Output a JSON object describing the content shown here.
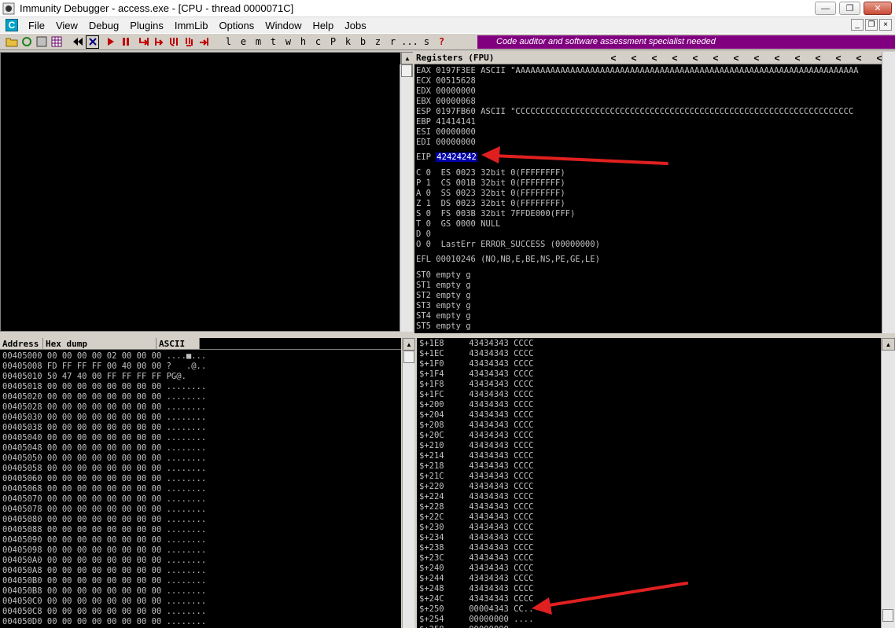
{
  "window": {
    "title": "Immunity Debugger - access.exe - [CPU - thread 0000071C]",
    "min": "—",
    "max": "❐",
    "close": "✕"
  },
  "menu": {
    "icon": "C",
    "items": [
      "File",
      "View",
      "Debug",
      "Plugins",
      "ImmLib",
      "Options",
      "Window",
      "Help",
      "Jobs"
    ],
    "mdi": [
      "_",
      "❐",
      "×"
    ]
  },
  "toolbar": {
    "letters": [
      "l",
      "e",
      "m",
      "t",
      "w",
      "h",
      "c",
      "P",
      "k",
      "b",
      "z",
      "r",
      "...",
      "s",
      "?"
    ],
    "banner": "Code auditor and software assessment specialist needed"
  },
  "registers": {
    "title": "Registers (FPU)",
    "chevrons": [
      "<",
      "<",
      "<",
      "<",
      "<",
      "<",
      "<",
      "<",
      "<",
      "<",
      "<",
      "<",
      "<",
      "<"
    ],
    "general": [
      "EAX 0197F3EE ASCII \"AAAAAAAAAAAAAAAAAAAAAAAAAAAAAAAAAAAAAAAAAAAAAAAAAAAAAAAAAAAAAAAAAAAAA",
      "ECX 00515628",
      "EDX 00000000",
      "EBX 00000068",
      "ESP 0197FB60 ASCII \"CCCCCCCCCCCCCCCCCCCCCCCCCCCCCCCCCCCCCCCCCCCCCCCCCCCCCCCCCCCCCCCCCCCC",
      "EBP 41414141",
      "ESI 00000000",
      "EDI 00000000"
    ],
    "eip_label": "EIP",
    "eip_value": "42424242",
    "flags": [
      "C 0  ES 0023 32bit 0(FFFFFFFF)",
      "P 1  CS 001B 32bit 0(FFFFFFFF)",
      "A 0  SS 0023 32bit 0(FFFFFFFF)",
      "Z 1  DS 0023 32bit 0(FFFFFFFF)",
      "S 0  FS 003B 32bit 7FFDE000(FFF)",
      "T 0  GS 0000 NULL",
      "D 0",
      "O 0  LastErr ERROR_SUCCESS (00000000)"
    ],
    "efl": "EFL 00010246 (NO,NB,E,BE,NS,PE,GE,LE)",
    "fpu": [
      "ST0 empty g",
      "ST1 empty g",
      "ST2 empty g",
      "ST3 empty g",
      "ST4 empty g",
      "ST5 empty g"
    ]
  },
  "dump": {
    "headers": [
      "Address",
      "Hex dump",
      "ASCII"
    ],
    "rows": [
      "00405000 00 00 00 00 02 00 00 00 ....■...",
      "00405008 FD FF FF FF 00 40 00 00 ?   .@..",
      "00405010 50 47 40 00 FF FF FF FF PG@.",
      "00405018 00 00 00 00 00 00 00 00 ........",
      "00405020 00 00 00 00 00 00 00 00 ........",
      "00405028 00 00 00 00 00 00 00 00 ........",
      "00405030 00 00 00 00 00 00 00 00 ........",
      "00405038 00 00 00 00 00 00 00 00 ........",
      "00405040 00 00 00 00 00 00 00 00 ........",
      "00405048 00 00 00 00 00 00 00 00 ........",
      "00405050 00 00 00 00 00 00 00 00 ........",
      "00405058 00 00 00 00 00 00 00 00 ........",
      "00405060 00 00 00 00 00 00 00 00 ........",
      "00405068 00 00 00 00 00 00 00 00 ........",
      "00405070 00 00 00 00 00 00 00 00 ........",
      "00405078 00 00 00 00 00 00 00 00 ........",
      "00405080 00 00 00 00 00 00 00 00 ........",
      "00405088 00 00 00 00 00 00 00 00 ........",
      "00405090 00 00 00 00 00 00 00 00 ........",
      "00405098 00 00 00 00 00 00 00 00 ........",
      "004050A0 00 00 00 00 00 00 00 00 ........",
      "004050A8 00 00 00 00 00 00 00 00 ........",
      "004050B0 00 00 00 00 00 00 00 00 ........",
      "004050B8 00 00 00 00 00 00 00 00 ........",
      "004050C0 00 00 00 00 00 00 00 00 ........",
      "004050C8 00 00 00 00 00 00 00 00 ........",
      "004050D0 00 00 00 00 00 00 00 00 ........"
    ]
  },
  "stack": {
    "rows": [
      "$+1E8     43434343 CCCC",
      "$+1EC     43434343 CCCC",
      "$+1F0     43434343 CCCC",
      "$+1F4     43434343 CCCC",
      "$+1F8     43434343 CCCC",
      "$+1FC     43434343 CCCC",
      "$+200     43434343 CCCC",
      "$+204     43434343 CCCC",
      "$+208     43434343 CCCC",
      "$+20C     43434343 CCCC",
      "$+210     43434343 CCCC",
      "$+214     43434343 CCCC",
      "$+218     43434343 CCCC",
      "$+21C     43434343 CCCC",
      "$+220     43434343 CCCC",
      "$+224     43434343 CCCC",
      "$+228     43434343 CCCC",
      "$+22C     43434343 CCCC",
      "$+230     43434343 CCCC",
      "$+234     43434343 CCCC",
      "$+238     43434343 CCCC",
      "$+23C     43434343 CCCC",
      "$+240     43434343 CCCC",
      "$+244     43434343 CCCC",
      "$+248     43434343 CCCC",
      "$+24C     43434343 CCCC",
      "$+250     00004343 CC..",
      "$+254     00000000 ....",
      "$+258     00000000"
    ]
  },
  "colors": {
    "annotation_arrow": "#e02020",
    "banner": "#800080",
    "eip_highlight": "#0000a8"
  }
}
